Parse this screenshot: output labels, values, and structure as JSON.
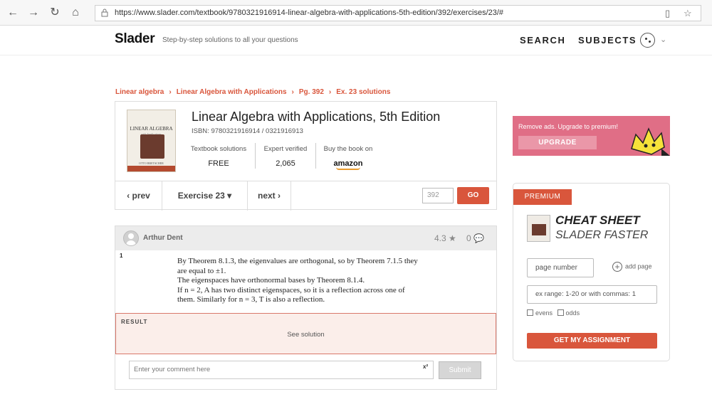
{
  "browser": {
    "url": "https://www.slader.com/textbook/9780321916914-linear-algebra-with-applications-5th-edition/392/exercises/23/#",
    "back_glyph": "←",
    "forward_glyph": "→",
    "refresh_glyph": "↻",
    "home_glyph": "⌂",
    "reading_glyph": "▯",
    "favorite_glyph": "☆"
  },
  "header": {
    "logo": "Slader",
    "tagline": "Step-by-step solutions to all your questions",
    "search_label": "SEARCH",
    "subjects_label": "SUBJECTS",
    "chevron": "⌄"
  },
  "breadcrumb": {
    "items": [
      "Linear algebra",
      "Linear Algebra with Applications",
      "Pg. 392",
      "Ex. 23 solutions"
    ],
    "separator": "›"
  },
  "book": {
    "title": "Linear Algebra with Applications, 5th Edition",
    "isbn": "ISBN: 9780321916914 / 0321916913",
    "cover_title": "LINEAR ALGEBRA",
    "cover_subtitle": "with Applications",
    "cover_author": "OTTO BRETSCHER",
    "stats": {
      "solutions_label": "Textbook solutions",
      "solutions_value": "FREE",
      "verified_label": "Expert verified",
      "verified_value": "2,065",
      "buy_label": "Buy the book on",
      "buy_value": "amazon"
    },
    "nav": {
      "prev": "‹ prev",
      "exercise": "Exercise 23 ▾",
      "next": "next ›",
      "page_placeholder": "392",
      "go": "GO"
    }
  },
  "solution": {
    "author": "Arthur Dent",
    "rating": "4.3 ★",
    "comments": "0 💬",
    "step": "1",
    "lines": [
      "By Theorem 8.1.3, the eigenvalues are orthogonal, so by Theorem 7.1.5 they",
      "are equal to ±1.",
      "The eigenspaces have orthonormal bases by Theorem 8.1.4.",
      "If n = 2, A has two distinct eigenspaces, so it is a reflection across one of",
      "them. Similarly for n = 3, T is also a reflection."
    ],
    "result_label": "RESULT",
    "see_solution": "See solution",
    "comment_placeholder": "Enter your comment here",
    "sup": "x²",
    "submit": "Submit"
  },
  "ad": {
    "text": "Remove ads. Upgrade to premium!",
    "button": "UPGRADE",
    "colors": {
      "banner": "#e06e86",
      "crown": "#f6e23a"
    }
  },
  "premium": {
    "tag": "PREMIUM",
    "line1": "CHEAT SHEET",
    "line2": "SLADER FASTER",
    "page_placeholder": "page number",
    "add_page": "add page",
    "add_glyph": "+",
    "ex_placeholder": "ex range: 1-20  or  with commas: 1",
    "evens": "evens",
    "odds": "odds",
    "assign_button": "GET MY ASSIGNMENT"
  },
  "colors": {
    "accent": "#d9563c"
  }
}
